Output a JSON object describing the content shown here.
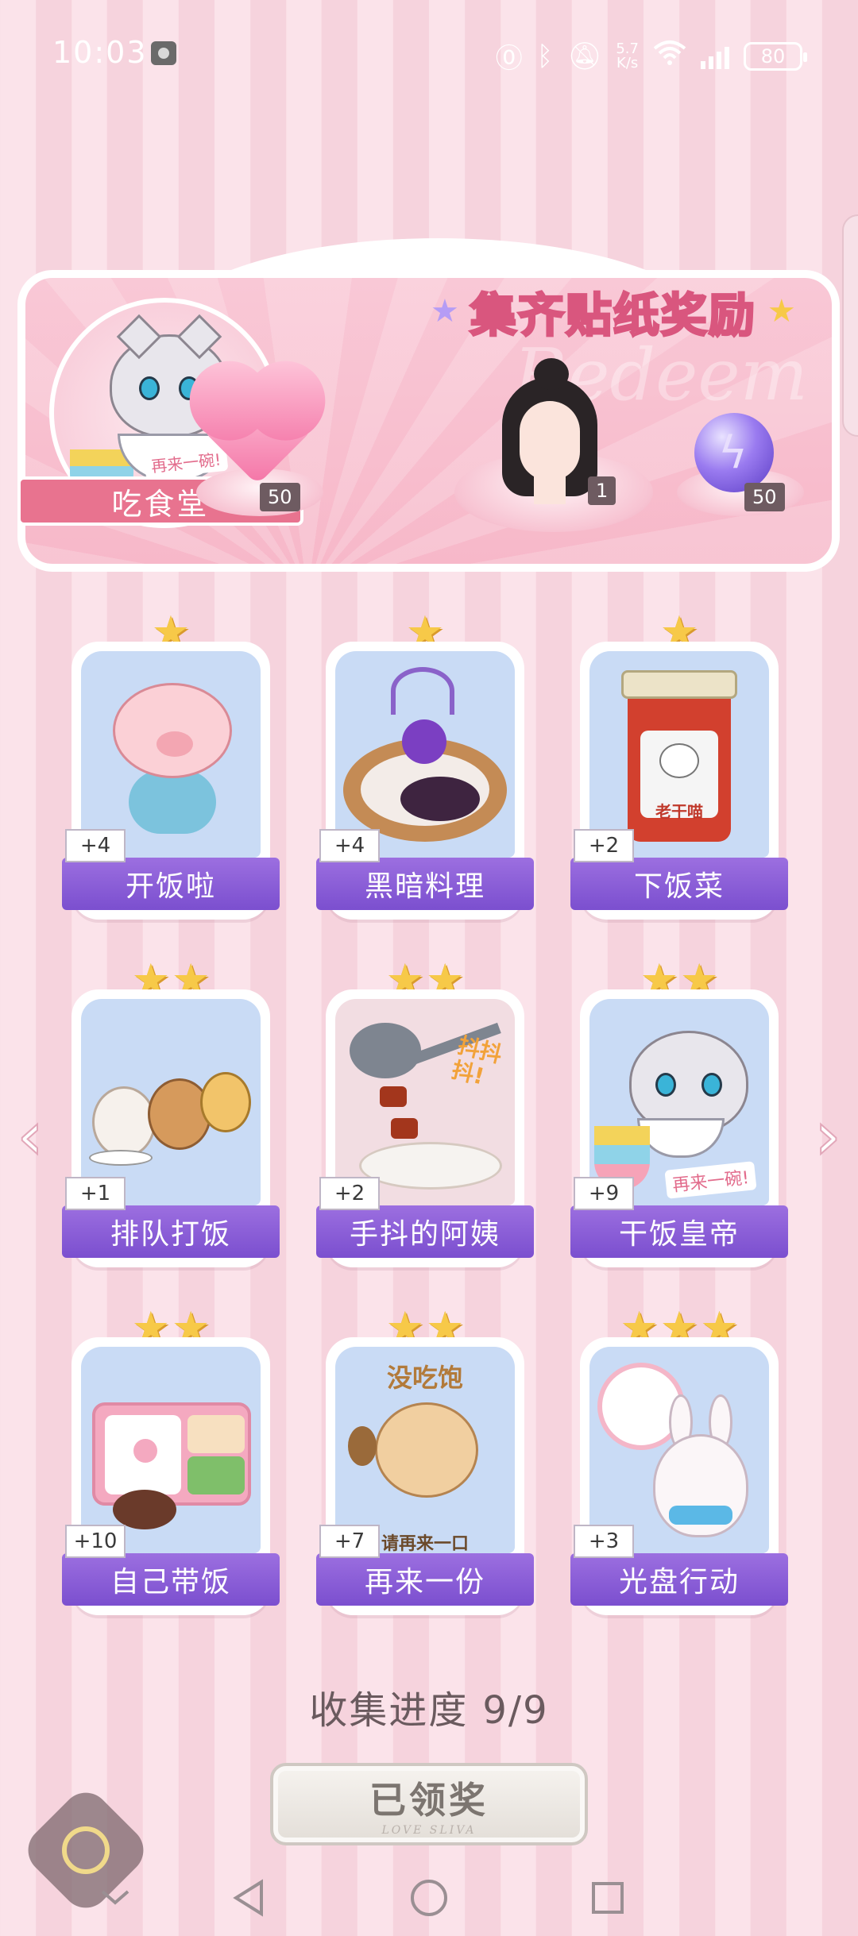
{
  "status_bar": {
    "time": "10:03",
    "net_speed_value": "5.7",
    "net_speed_unit": "K/s",
    "battery": "80",
    "icons": [
      "camera-icon",
      "nfc-icon",
      "bluetooth-icon",
      "mute-icon",
      "wifi-icon",
      "signal-icon",
      "battery-icon"
    ]
  },
  "banner": {
    "title": "集齐贴纸奖励",
    "watermark": "Redeem",
    "cafeteria_label": "吃食堂",
    "cafeteria_sub": "再来一碗!",
    "rewards": [
      {
        "name": "heart-gem",
        "count": "50"
      },
      {
        "name": "portrait",
        "count": "1"
      },
      {
        "name": "purple-orb",
        "count": "50"
      }
    ]
  },
  "stickers": [
    {
      "label": "开饭啦",
      "stars": 1,
      "bonus": "+4"
    },
    {
      "label": "黑暗料理",
      "stars": 1,
      "bonus": "+4"
    },
    {
      "label": "下饭菜",
      "stars": 1,
      "bonus": "+2",
      "jar_text": "老干喵"
    },
    {
      "label": "排队打饭",
      "stars": 2,
      "bonus": "+1"
    },
    {
      "label": "手抖的阿姨",
      "stars": 2,
      "bonus": "+2",
      "art_text": "抖抖抖!"
    },
    {
      "label": "干饭皇帝",
      "stars": 2,
      "bonus": "+9",
      "art_text": "再来一碗!"
    },
    {
      "label": "自己带饭",
      "stars": 2,
      "bonus": "+10"
    },
    {
      "label": "再来一份",
      "stars": 2,
      "bonus": "+7",
      "art_text": "没吃饱",
      "art_sub": "请再来一口"
    },
    {
      "label": "光盘行动",
      "stars": 3,
      "bonus": "+3"
    }
  ],
  "progress": {
    "label": "收集进度",
    "value": "9/9"
  },
  "claim_button": {
    "label": "已领奖",
    "sub": "LOVE SLIVA"
  },
  "colors": {
    "label_purple": "#8a5ed8",
    "banner_pink": "#f7b8c9",
    "star_gold": "#f7c948",
    "card_bg": "#c9dbf5"
  }
}
